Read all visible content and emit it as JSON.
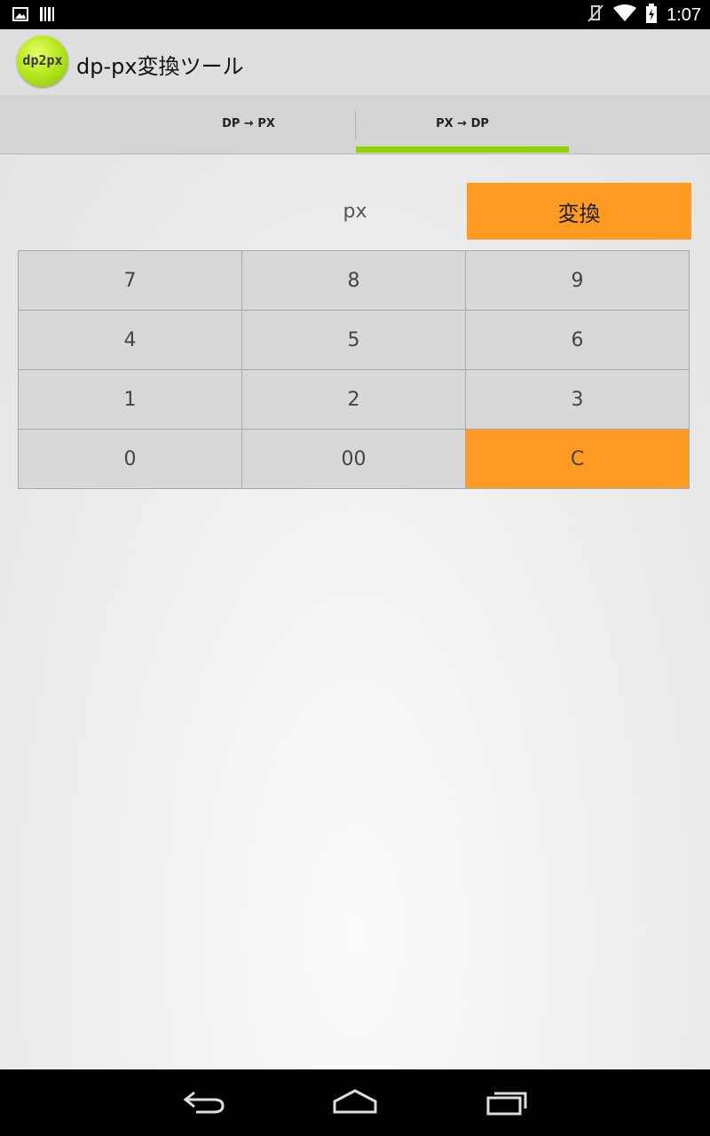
{
  "status_bar": {
    "time": "1:07",
    "icons": [
      "image-icon",
      "barcode-icon",
      "vibrate-off-icon",
      "wifi-icon",
      "battery-icon"
    ]
  },
  "app": {
    "icon_text": "dp2px",
    "title": "dp-px変換ツール"
  },
  "tabs": [
    {
      "label": "DP → PX",
      "selected": false
    },
    {
      "label": "PX → DP",
      "selected": true
    }
  ],
  "colors": {
    "accent": "#ff9a22",
    "tab_indicator": "#8fd400"
  },
  "converter": {
    "unit_label": "px",
    "convert_label": "変換"
  },
  "keypad": {
    "keys": [
      "7",
      "8",
      "9",
      "4",
      "5",
      "6",
      "1",
      "2",
      "3",
      "0",
      "00",
      "C"
    ]
  },
  "nav_bar": {
    "icons": [
      "back-icon",
      "home-icon",
      "recent-apps-icon"
    ]
  }
}
